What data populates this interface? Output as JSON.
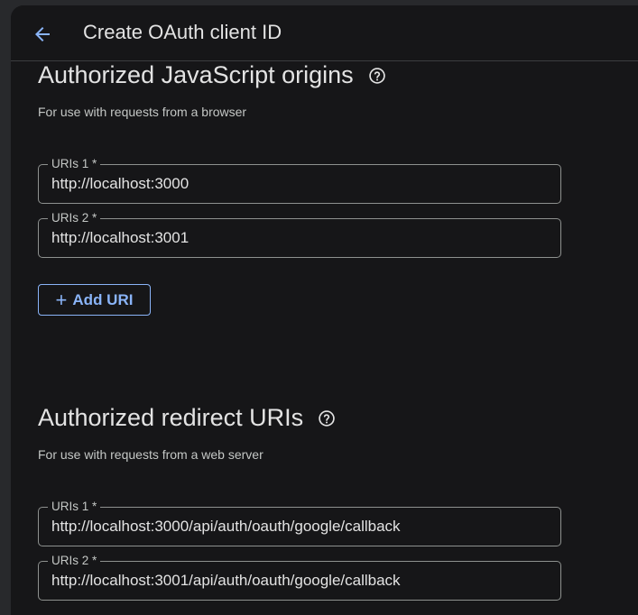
{
  "header": {
    "title": "Create OAuth client ID",
    "back_icon": "arrow-left-icon"
  },
  "js_origins": {
    "title": "Authorized JavaScript origins",
    "subtitle": "For use with requests from a browser",
    "help_icon": "help-circle-icon",
    "fields": [
      {
        "label": "URIs 1 *",
        "value": "http://localhost:3000"
      },
      {
        "label": "URIs 2 *",
        "value": "http://localhost:3001"
      }
    ],
    "add_label": "Add URI"
  },
  "redirect_uris": {
    "title": "Authorized redirect URIs",
    "subtitle": "For use with requests from a web server",
    "help_icon": "help-circle-icon",
    "fields": [
      {
        "label": "URIs 1 *",
        "value": "http://localhost:3000/api/auth/oauth/google/callback"
      },
      {
        "label": "URIs 2 *",
        "value": "http://localhost:3001/api/auth/oauth/google/callback"
      }
    ]
  },
  "colors": {
    "background": "#161618",
    "accent": "#8ab4f8",
    "border": "#8e918f"
  }
}
